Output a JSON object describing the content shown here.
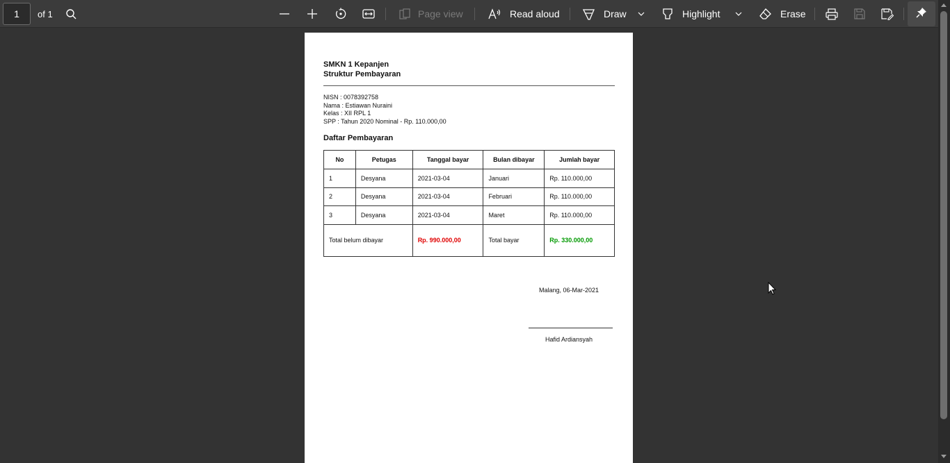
{
  "toolbar": {
    "page_number": "1",
    "of_label": "of 1",
    "page_view_label": "Page view",
    "read_aloud_label": "Read aloud",
    "draw_label": "Draw",
    "highlight_label": "Highlight",
    "erase_label": "Erase"
  },
  "document": {
    "school": "SMKN 1 Kepanjen",
    "subtitle": "Struktur Pembayaran",
    "nisn": "NISN : 0078392758",
    "nama": "Nama : Estiawan Nuraini",
    "kelas": "Kelas : XII RPL 1",
    "spp": "SPP : Tahun 2020 Nominal - Rp. 110.000,00",
    "section_title": "Daftar Pembayaran",
    "table": {
      "headers": [
        "No",
        "Petugas",
        "Tanggal bayar",
        "Bulan dibayar",
        "Jumlah bayar"
      ],
      "rows": [
        [
          "1",
          "Desyana",
          "2021-03-04",
          "Januari",
          "Rp. 110.000,00"
        ],
        [
          "2",
          "Desyana",
          "2021-03-04",
          "Februari",
          "Rp. 110.000,00"
        ],
        [
          "3",
          "Desyana",
          "2021-03-04",
          "Maret",
          "Rp. 110.000,00"
        ]
      ],
      "total": {
        "unpaid_label": "Total belum dibayar",
        "unpaid_value": "Rp. 990.000,00",
        "paid_label": "Total bayar",
        "paid_value": "Rp. 330.000,00"
      }
    },
    "city_date": "Malang, 06-Mar-2021",
    "signer": "Hafid Ardiansyah"
  },
  "colors": {
    "unpaid": "#e00000",
    "paid": "#009900",
    "toolbar_bg": "#3b3b3b",
    "viewer_bg": "#333333"
  },
  "icons": [
    "search-icon",
    "zoom-out-icon",
    "zoom-in-icon",
    "rotate-icon",
    "fit-page-icon",
    "page-view-icon",
    "read-aloud-icon",
    "draw-icon",
    "chevron-down-icon",
    "highlight-icon",
    "erase-icon",
    "print-icon",
    "save-icon",
    "save-as-icon",
    "pin-icon"
  ]
}
